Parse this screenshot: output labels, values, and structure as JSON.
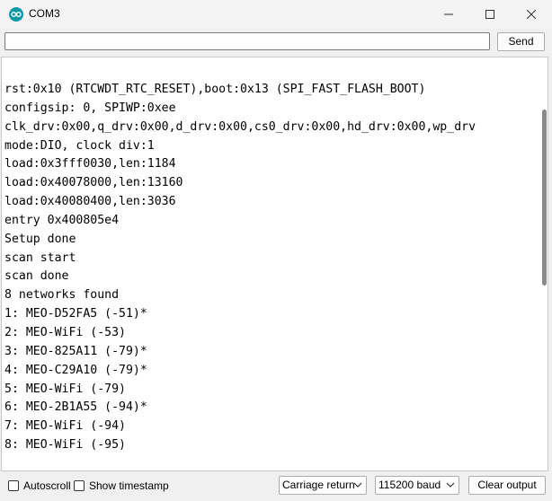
{
  "window": {
    "title": "COM3",
    "minimize_icon": "minimize-icon",
    "maximize_icon": "maximize-icon",
    "close_icon": "close-icon",
    "app_icon": "arduino-icon",
    "accent": "#0d9aa6"
  },
  "send_bar": {
    "input_value": "",
    "send_label": "Send"
  },
  "console": {
    "lines": [
      "rst:0x10 (RTCWDT_RTC_RESET),boot:0x13 (SPI_FAST_FLASH_BOOT)",
      "configsip: 0, SPIWP:0xee",
      "clk_drv:0x00,q_drv:0x00,d_drv:0x00,cs0_drv:0x00,hd_drv:0x00,wp_drv",
      "mode:DIO, clock div:1",
      "load:0x3fff0030,len:1184",
      "load:0x40078000,len:13160",
      "load:0x40080400,len:3036",
      "entry 0x400805e4",
      "Setup done",
      "scan start",
      "scan done",
      "8 networks found",
      "1: MEO-D52FA5 (-51)*",
      "2: MEO-WiFi (-53)",
      "3: MEO-825A11 (-79)*",
      "4: MEO-C29A10 (-79)*",
      "5: MEO-WiFi (-79)",
      "6: MEO-2B1A55 (-94)*",
      "7: MEO-WiFi (-94)",
      "8: MEO-WiFi (-95)"
    ]
  },
  "bottom_bar": {
    "autoscroll_label": "Autoscroll",
    "autoscroll_checked": false,
    "timestamp_label": "Show timestamp",
    "timestamp_checked": false,
    "line_ending": "Carriage return",
    "baud_rate": "115200 baud",
    "clear_label": "Clear output",
    "dropdown_icon": "chevron-down-icon"
  }
}
